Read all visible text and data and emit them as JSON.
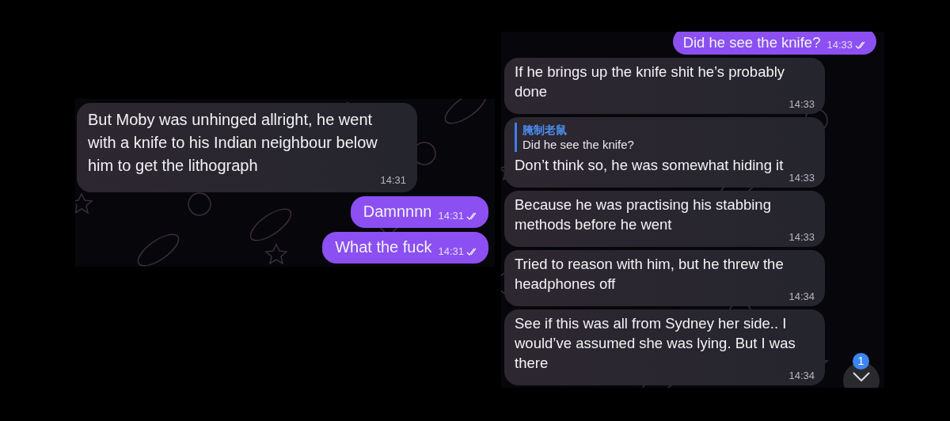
{
  "panels": [
    {
      "messages": [
        {
          "kind": "incoming",
          "text": "But Moby was unhinged allright, he went with a knife to his Indian neighbour below him to get the lithograph",
          "time": "14:31"
        },
        {
          "kind": "outgoing",
          "text": "Damnnnn",
          "time": "14:31",
          "read": true
        },
        {
          "kind": "outgoing",
          "text": "What the fuck",
          "time": "14:31",
          "read": true
        }
      ]
    },
    {
      "messages": [
        {
          "kind": "outgoing",
          "text": "Did he see the knife?",
          "time": "14:33",
          "read": true
        },
        {
          "kind": "incoming",
          "text": "If he brings up the knife shit he’s probably done",
          "time": "14:33"
        },
        {
          "kind": "incoming",
          "reply": {
            "author": "腌制老鼠",
            "text": "Did he see the knife?"
          },
          "text": "Don’t think so, he was somewhat hiding it",
          "time": "14:33"
        },
        {
          "kind": "incoming",
          "text": "Because he was practising his stabbing methods before he went",
          "time": "14:33"
        },
        {
          "kind": "incoming",
          "text": "Tried to reason with him, but he threw the headphones off",
          "time": "14:34"
        },
        {
          "kind": "incoming",
          "text": "See if this was all from Sydney her side.. I would’ve assumed she was lying. But I was there",
          "time": "14:34"
        }
      ],
      "scroll_button": {
        "badge": "1"
      }
    }
  ]
}
